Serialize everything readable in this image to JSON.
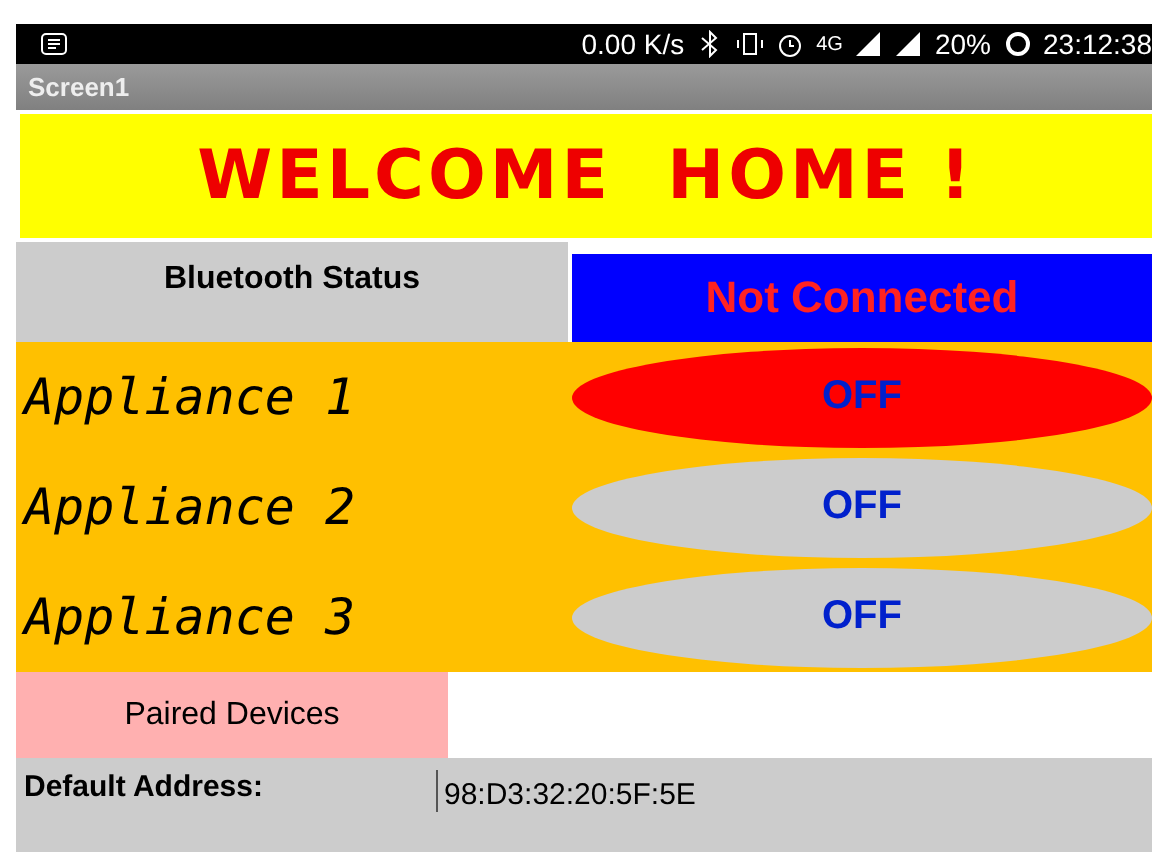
{
  "status_bar": {
    "speed": "0.00 K/s",
    "network": "4G",
    "battery": "20%",
    "time": "23:12:38"
  },
  "title_bar": {
    "title": "Screen1"
  },
  "banner": {
    "text": "WELCOME  HOME !"
  },
  "bluetooth": {
    "label": "Bluetooth Status",
    "status": "Not Connected"
  },
  "appliances": [
    {
      "name": "Appliance 1",
      "button": "OFF",
      "color": "#ff0000"
    },
    {
      "name": "Appliance 2",
      "button": "OFF",
      "color": "#cccccc"
    },
    {
      "name": "Appliance 3",
      "button": "OFF",
      "color": "#cccccc"
    }
  ],
  "paired_button": "Paired Devices",
  "address": {
    "label": "Default Address:",
    "value": "98:D3:32:20:5F:5E"
  }
}
